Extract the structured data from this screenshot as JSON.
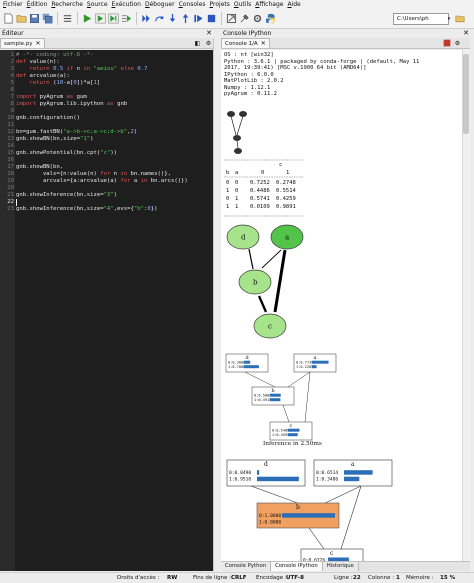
{
  "menubar": {
    "items": [
      "Fichier",
      "Édition",
      "Recherche",
      "Source",
      "Exécution",
      "Déboguer",
      "Consoles",
      "Projets",
      "Outils",
      "Affichage",
      "Aide"
    ]
  },
  "toolbar": {
    "buttons": [
      "new-file-icon",
      "open-folder-icon",
      "save-icon",
      "save-all-icon",
      "list-icon",
      "run-icon",
      "run-cell-icon",
      "run-cell-advance-icon",
      "run-selection-icon",
      "debug-icon",
      "step-icon",
      "step-into-icon",
      "step-return-icon",
      "continue-icon",
      "stop-icon",
      "maximize-icon",
      "preferences-icon",
      "settings-icon",
      "python-path-icon"
    ],
    "cwd": "C:\\Users\\ph"
  },
  "editor": {
    "pane_title": "Éditeur",
    "tab": "sample.py",
    "lines": [
      "# -*- coding: utf-8 -*-",
      "def value(n):",
      "    return 0.5 if n in \"aeiou\" else 0.7",
      "def arcvalue(a):",
      "    return (10-a[0])*a[1]",
      "",
      "import pyAgrum as gum",
      "import pyAgrum.lib.ipython as gnb",
      "",
      "gnb.configuration()",
      "",
      "bn=gum.fastBN(\"a->b->c;a->c;d->b\",2)",
      "gnb.showBN(bn,size=\"1\")",
      "",
      "gnb.showPotential(bn.cpt(\"c\"))",
      "",
      "gnb.showBN(bn,",
      "        vals={n:value(n) for n in bn.names()},",
      "        arcvals={a:arcvalue(a) for a in bn.arcs()})",
      "",
      "gnb.showInference(bn,size=\"3\")",
      "",
      "gnb.showInference(bn,size=\"4\",evs={\"b\":0})"
    ],
    "current_line": 22
  },
  "console": {
    "pane_title": "Console IPython",
    "tab": "Console 1/A",
    "header_lines": [
      "OS : nt [win32]",
      "Python : 3.6.1 | packaged by conda-forge | (default, May 11",
      "2017, 19:39:41) [MSC v.1900 64 bit (AMD64)]",
      "IPython : 6.0.0",
      "MatPlotLib : 2.0.2",
      "Numpy : 1.12.1",
      "pyAgrum : 0.11.2"
    ],
    "cpt_table": {
      "col_var": "c",
      "col_values": [
        "0",
        "1"
      ],
      "row_vars": [
        "b",
        "a"
      ],
      "rows": [
        [
          "0",
          "0",
          "0.7252",
          "0.2748"
        ],
        [
          "1",
          "0",
          "0.4486",
          "0.5514"
        ],
        [
          "0",
          "1",
          "0.5741",
          "0.4259"
        ],
        [
          "1",
          "1",
          "0.0109",
          "0.9891"
        ]
      ]
    },
    "graph_nodes": [
      "d",
      "a",
      "b",
      "c"
    ],
    "inference1": {
      "d": [
        "0.3000",
        "0.7000"
      ],
      "a": [
        "0.7737",
        "0.2263"
      ],
      "b": [
        "0.5083",
        "0.4917"
      ],
      "c": [
        "0.5409",
        "0.4591"
      ],
      "caption": "Inference in   2.50ms"
    },
    "inference2": {
      "d": [
        "0.0490",
        "0.9510"
      ],
      "a": [
        "0.6514",
        "0.3486"
      ],
      "b": [
        "1.0000",
        "0.0000"
      ],
      "c_partial": "0.6726"
    }
  },
  "bottom_tabs": [
    "Console Python",
    "Console IPython",
    "Historique"
  ],
  "statusbar": {
    "access_label": "Droits d'accès :",
    "access": "RW",
    "eol_label": "Fins de ligne :",
    "eol": "CRLF",
    "enc_label": "Encodage :",
    "enc": "UTF-8",
    "line_label": "Ligne :",
    "line": "22",
    "col_label": "Colonne :",
    "col": "1",
    "mem_label": "Mémoire :",
    "mem": "15 %"
  },
  "colors": {
    "accent_green": "#2e9a2e",
    "node_green": "#a6e38a",
    "bar_blue": "#2c6fb8",
    "evidence_orange": "#f0a060"
  }
}
